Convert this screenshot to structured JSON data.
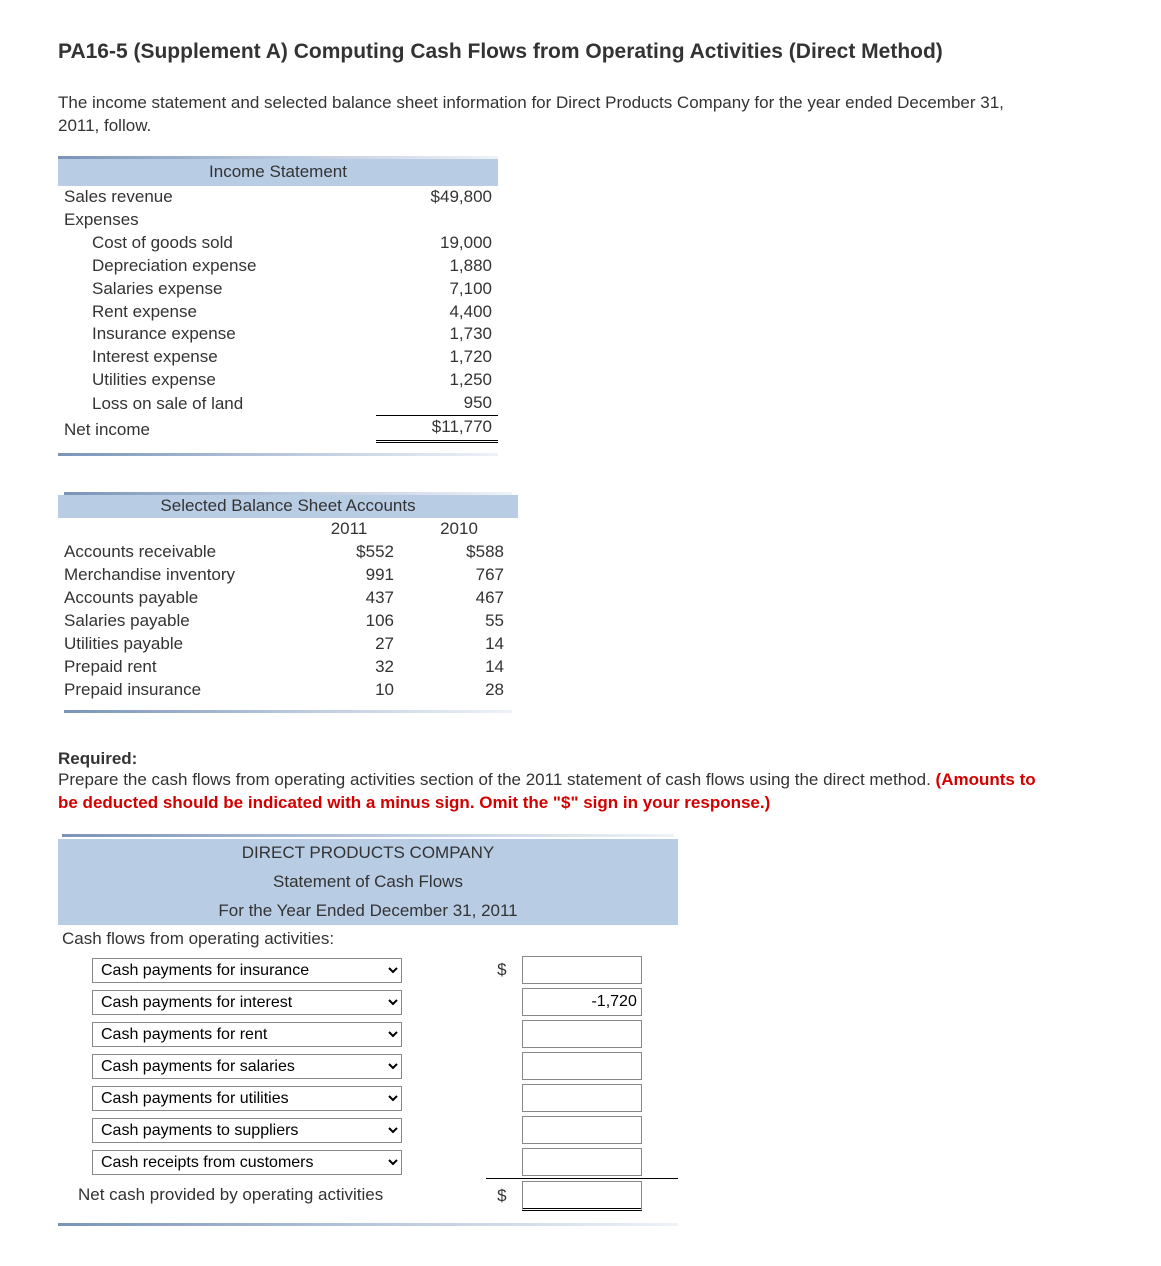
{
  "title": "PA16-5 (Supplement A) Computing Cash Flows from Operating Activities (Direct Method)",
  "intro": "The income statement and selected balance sheet information for Direct Products Company for the year ended December 31, 2011, follow.",
  "income_statement": {
    "header": "Income Statement",
    "rows": [
      {
        "label": "Sales revenue",
        "value": "$49,800",
        "indent": false
      },
      {
        "label": "Expenses",
        "value": "",
        "indent": false
      },
      {
        "label": "Cost of goods sold",
        "value": "19,000",
        "indent": true
      },
      {
        "label": "Depreciation expense",
        "value": "1,880",
        "indent": true
      },
      {
        "label": "Salaries expense",
        "value": "7,100",
        "indent": true
      },
      {
        "label": "Rent expense",
        "value": "4,400",
        "indent": true
      },
      {
        "label": "Insurance expense",
        "value": "1,730",
        "indent": true
      },
      {
        "label": "Interest expense",
        "value": "1,720",
        "indent": true
      },
      {
        "label": "Utilities expense",
        "value": "1,250",
        "indent": true
      },
      {
        "label": "Loss on sale of land",
        "value": "950",
        "indent": true,
        "underline": true
      }
    ],
    "net_label": "Net income",
    "net_value": "$11,770"
  },
  "balance_sheet": {
    "header": "Selected Balance Sheet Accounts",
    "year1": "2011",
    "year2": "2010",
    "rows": [
      {
        "label": "Accounts receivable",
        "v1": "$552",
        "v2": "$588"
      },
      {
        "label": "Merchandise inventory",
        "v1": "991",
        "v2": "767"
      },
      {
        "label": "Accounts payable",
        "v1": "437",
        "v2": "467"
      },
      {
        "label": "Salaries payable",
        "v1": "106",
        "v2": "55"
      },
      {
        "label": "Utilities payable",
        "v1": "27",
        "v2": "14"
      },
      {
        "label": "Prepaid rent",
        "v1": "32",
        "v2": "14"
      },
      {
        "label": "Prepaid insurance",
        "v1": "10",
        "v2": "28"
      }
    ]
  },
  "required": {
    "label": "Required:",
    "text": "Prepare the cash flows from operating activities section of the 2011 statement of cash flows using the direct method. ",
    "note": "(Amounts to be deducted should be indicated with a minus sign. Omit the \"$\" sign in your response.)"
  },
  "answer": {
    "company": "DIRECT PRODUCTS COMPANY",
    "stmt": "Statement of Cash Flows",
    "period": "For the Year Ended December 31, 2011",
    "section": "Cash flows from operating activities:",
    "lines": [
      {
        "select": "Cash payments for insurance",
        "dollar": "$",
        "value": ""
      },
      {
        "select": "Cash payments for interest",
        "dollar": "",
        "value": "-1,720"
      },
      {
        "select": "Cash payments for rent",
        "dollar": "",
        "value": ""
      },
      {
        "select": "Cash payments for salaries",
        "dollar": "",
        "value": ""
      },
      {
        "select": "Cash payments for utilities",
        "dollar": "",
        "value": ""
      },
      {
        "select": "Cash payments to suppliers",
        "dollar": "",
        "value": ""
      },
      {
        "select": "Cash receipts from customers",
        "dollar": "",
        "value": ""
      }
    ],
    "net_label": "Net cash provided by operating activities",
    "net_dollar": "$",
    "net_value": ""
  }
}
